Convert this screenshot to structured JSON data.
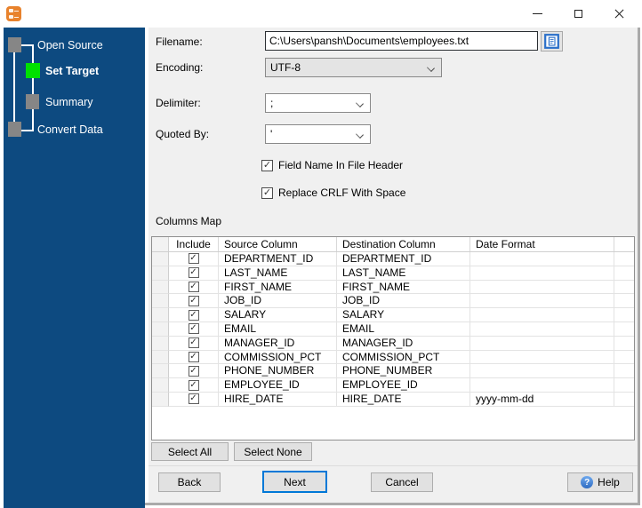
{
  "titlebar": {
    "title": ""
  },
  "sidebar": {
    "steps": [
      {
        "label": "Open Source",
        "state": "done"
      },
      {
        "label": "Set Target",
        "state": "active"
      },
      {
        "label": "Summary",
        "state": "pending"
      },
      {
        "label": "Convert Data",
        "state": "pending"
      }
    ]
  },
  "form": {
    "filename": {
      "label": "Filename:",
      "value": "C:\\Users\\pansh\\Documents\\employees.txt"
    },
    "encoding": {
      "label": "Encoding:",
      "value": "UTF-8"
    },
    "delimiter": {
      "label": "Delimiter:",
      "value": ";"
    },
    "quoted_by": {
      "label": "Quoted By:",
      "value": "'"
    },
    "checkboxes": [
      {
        "label": "Field Name In File Header",
        "checked": true
      },
      {
        "label": "Replace CRLF With Space",
        "checked": true
      }
    ]
  },
  "columns_map": {
    "title": "Columns Map",
    "headers": [
      "",
      "Include",
      "Source Column",
      "Destination Column",
      "Date Format",
      ""
    ],
    "rows": [
      {
        "include": true,
        "source": "DEPARTMENT_ID",
        "destination": "DEPARTMENT_ID",
        "date_format": ""
      },
      {
        "include": true,
        "source": "LAST_NAME",
        "destination": "LAST_NAME",
        "date_format": ""
      },
      {
        "include": true,
        "source": "FIRST_NAME",
        "destination": "FIRST_NAME",
        "date_format": ""
      },
      {
        "include": true,
        "source": "JOB_ID",
        "destination": "JOB_ID",
        "date_format": ""
      },
      {
        "include": true,
        "source": "SALARY",
        "destination": "SALARY",
        "date_format": ""
      },
      {
        "include": true,
        "source": "EMAIL",
        "destination": "EMAIL",
        "date_format": ""
      },
      {
        "include": true,
        "source": "MANAGER_ID",
        "destination": "MANAGER_ID",
        "date_format": ""
      },
      {
        "include": true,
        "source": "COMMISSION_PCT",
        "destination": "COMMISSION_PCT",
        "date_format": ""
      },
      {
        "include": true,
        "source": "PHONE_NUMBER",
        "destination": "PHONE_NUMBER",
        "date_format": ""
      },
      {
        "include": true,
        "source": "EMPLOYEE_ID",
        "destination": "EMPLOYEE_ID",
        "date_format": ""
      },
      {
        "include": true,
        "source": "HIRE_DATE",
        "destination": "HIRE_DATE",
        "date_format": "yyyy-mm-dd"
      }
    ]
  },
  "actions": {
    "select_all": "Select All",
    "select_none": "Select None",
    "back": "Back",
    "next": "Next",
    "cancel": "Cancel",
    "help": "Help"
  },
  "icons": {
    "check_glyph": "✓",
    "help_glyph": "?"
  },
  "colors": {
    "sidebar_blue": "#0d4a80",
    "active_step_green": "#00e100",
    "inactive_step_gray": "#868686",
    "next_button_accent": "#0078d7",
    "panel_bg": "#f0f0f0"
  }
}
